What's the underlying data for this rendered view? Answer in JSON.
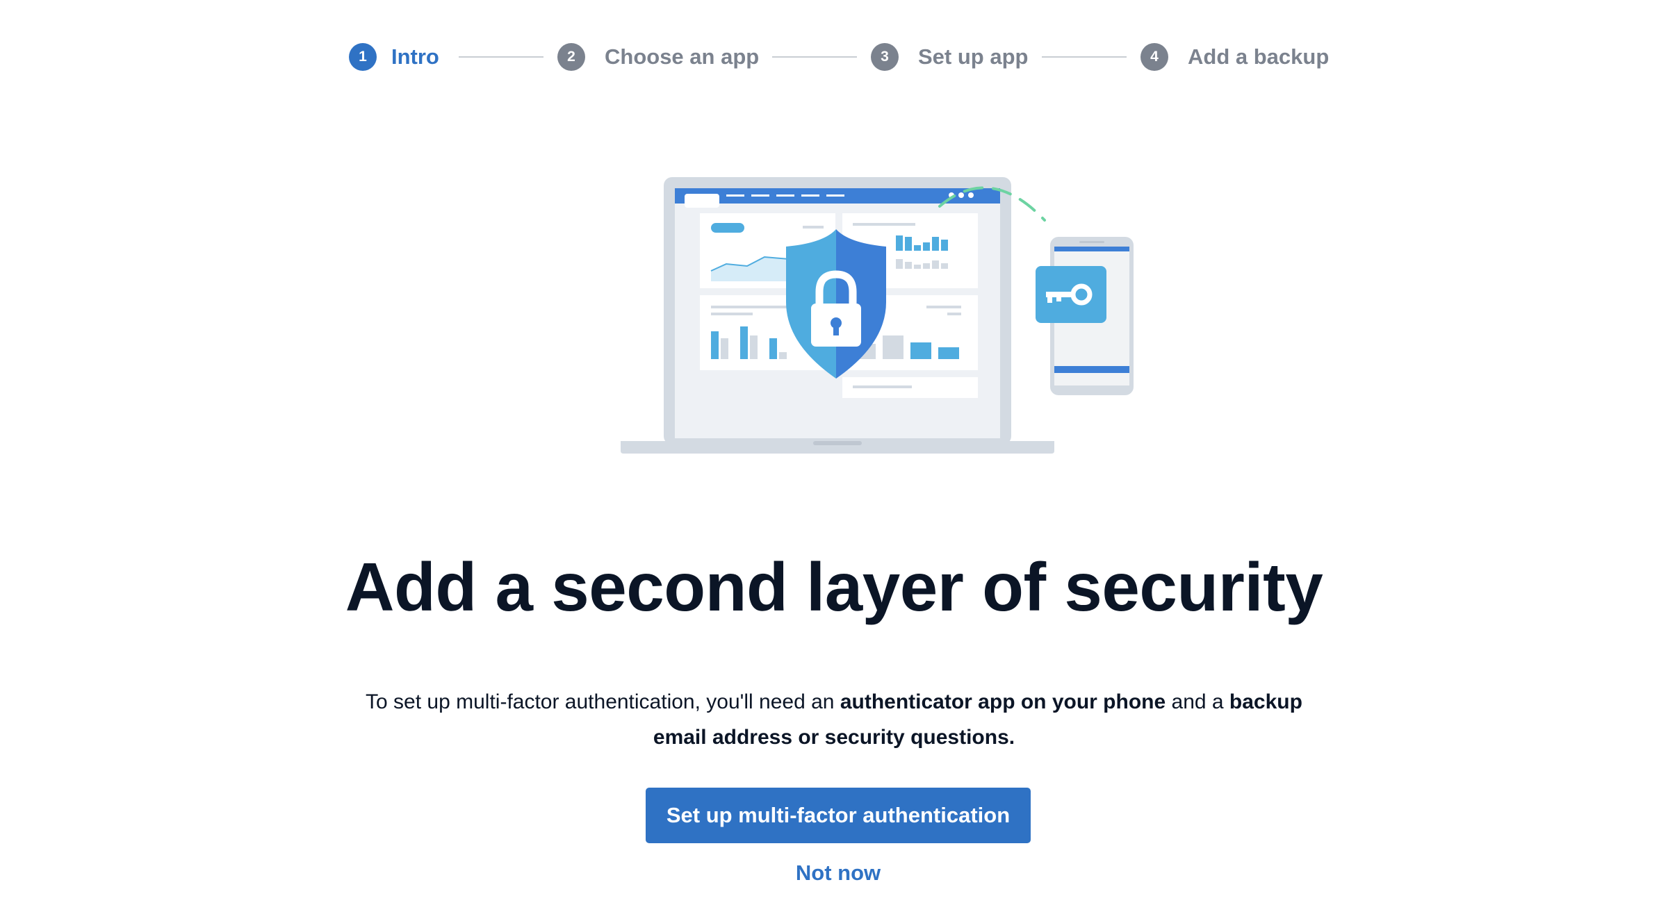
{
  "stepper": {
    "steps": [
      {
        "number": "1",
        "label": "Intro",
        "state": "active"
      },
      {
        "number": "2",
        "label": "Choose an app",
        "state": "upcoming"
      },
      {
        "number": "3",
        "label": "Set up app",
        "state": "upcoming"
      },
      {
        "number": "4",
        "label": "Add a backup",
        "state": "upcoming"
      }
    ]
  },
  "illustration": {
    "icons": [
      "laptop-dashboard",
      "shield-lock-icon",
      "phone",
      "key-icon"
    ]
  },
  "main": {
    "heading": "Add a second layer of security",
    "description": {
      "part1": "To set up multi-factor authentication, you'll need an ",
      "bold1": "authenticator app on your phone",
      "part2": " and a ",
      "bold2": "backup email address or security questions."
    },
    "primary_button_label": "Set up multi-factor authentication",
    "secondary_link_label": "Not now"
  },
  "colors": {
    "accent": "#2f72c4",
    "inactive_step": "#7b828e",
    "heading_text": "#0b1526",
    "connector_line": "#c9cdd3",
    "illustration_blue": "#4facdf",
    "illustration_green": "#6dd3a2"
  }
}
